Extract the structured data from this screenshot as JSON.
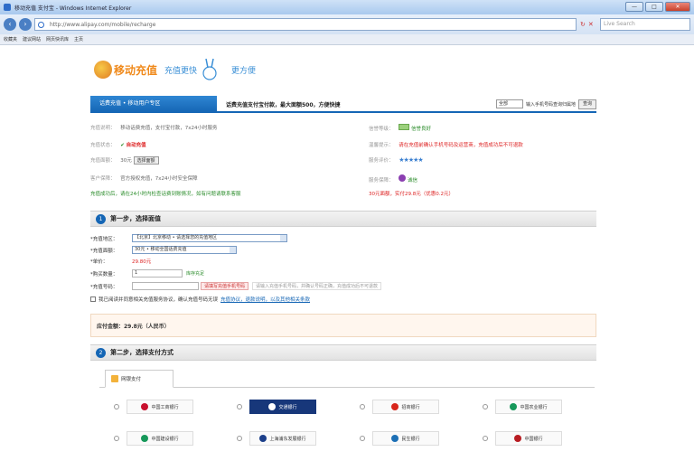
{
  "browser": {
    "title": "移动充值 支付宝 - Windows Internet Explorer",
    "url": "http://www.alipay.com/mobile/recharge",
    "search_placeholder": "Live Search",
    "favorites": [
      "收藏夹",
      "建议网站",
      "网页快讯库",
      "主页"
    ],
    "window_controls": [
      "—",
      "□",
      "✕"
    ]
  },
  "logo": {
    "brand": "移动充值",
    "slogan": "充值更快",
    "slogan2": "更方便"
  },
  "tabbar": {
    "active_tab": "话费充值 • 移动用户专区",
    "info": "话费充值支付宝付款，最大面额500，方便快捷",
    "select_value": "全部",
    "select_hint": "输入手机号码查询归属地",
    "button": "查询"
  },
  "info": {
    "left": [
      {
        "label": "充值说明：",
        "value": "移动话费充值，支付宝付款，7x24小时服务"
      },
      {
        "label": "充值状态：",
        "value": "自动充值"
      },
      {
        "label": "充值面额：",
        "value": "30元",
        "button": "选择面额"
      },
      {
        "label": "客户保障：",
        "value": "官方授权充值，7x24小时安全保障"
      },
      {
        "label": "",
        "value": "充值成功后，请在24小时内检查话费到账情况，如有问题请联系客服"
      }
    ],
    "right": [
      {
        "label": "信誉等级：",
        "value": "信誉良好"
      },
      {
        "label": "温馨提示：",
        "value": "请在充值前确认手机号码及运营商，充值成功后不可退款"
      },
      {
        "label": "服务评价：",
        "value": "★★★★★"
      },
      {
        "label": "服务保障：",
        "value": "诚信"
      },
      {
        "label": "",
        "value": "30元面额，实付29.8元（优惠0.2元）"
      }
    ]
  },
  "step1": {
    "num": "1",
    "title": "第一步，选择面值"
  },
  "form": {
    "province_label": "*充值地区：",
    "province_value": "【北京】北京移动 • 请选择您的充值地区",
    "product_label": "*充值面额：",
    "product_value": "30元 • 移动全国话费充值",
    "price_label": "*单价：",
    "price_value": "29.80元",
    "qty_label": "*购买数量：",
    "qty_value": "1",
    "qty_hint": "库存充足",
    "phone_label": "*充值号码：",
    "phone_value": "",
    "phone_button": "请填写充值手机号码",
    "phone_hint": "请输入充值手机号码，并确认号码正确，充值成功后不可退款",
    "agree_text": "我已阅读并同意相关充值服务协议，确认充值号码无误",
    "agree_link": "充值协议，退款说明，以及其他相关条款"
  },
  "summary": {
    "text": "应付金额：29.8元（人民币）"
  },
  "step2": {
    "num": "2",
    "title": "第二步，选择支付方式"
  },
  "bank_tab": {
    "label": "网银支付"
  },
  "banks": [
    {
      "name": "中国工商银行",
      "color": "#c8102e"
    },
    {
      "name": "交通银行",
      "color": "#17377a",
      "dark": true
    },
    {
      "name": "招商银行",
      "color": "#d8261c"
    },
    {
      "name": "中国农业银行",
      "color": "#16985a"
    },
    {
      "name": "中国建设银行",
      "color": "#16985a"
    },
    {
      "name": "上海浦东发展银行",
      "color": "#1c3f8a"
    },
    {
      "name": "民生银行",
      "color": "#1c6fb5"
    },
    {
      "name": "中国银行",
      "color": "#b81c22"
    }
  ]
}
